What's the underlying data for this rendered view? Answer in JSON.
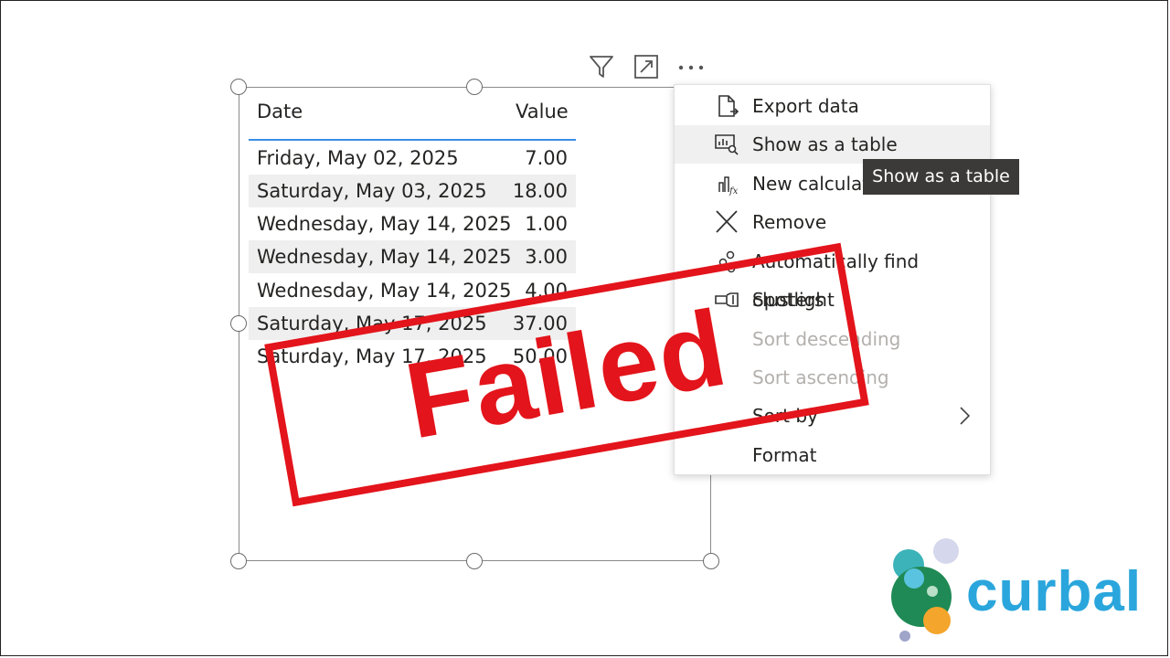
{
  "table": {
    "headers": {
      "date": "Date",
      "value": "Value"
    },
    "rows": [
      {
        "date": "Friday, May 02, 2025",
        "value": "7.00"
      },
      {
        "date": "Saturday, May 03, 2025",
        "value": "18.00"
      },
      {
        "date": "Wednesday, May 14, 2025",
        "value": "1.00"
      },
      {
        "date": "Wednesday, May 14, 2025",
        "value": "3.00"
      },
      {
        "date": "Wednesday, May 14, 2025",
        "value": "4.00"
      },
      {
        "date": "Saturday, May 17, 2025",
        "value": "37.00"
      },
      {
        "date": "Saturday, May 17, 2025",
        "value": "50.00"
      }
    ]
  },
  "visual_header_icons": [
    "filter-icon",
    "focus-mode-icon",
    "more-options-icon"
  ],
  "context_menu": {
    "items": [
      {
        "label": "Export data",
        "icon": "export-data-icon",
        "state": "normal"
      },
      {
        "label": "Show as a table",
        "icon": "show-as-table-icon",
        "state": "highlighted"
      },
      {
        "label": "New calculation",
        "icon": "new-calculation-icon",
        "state": "normal"
      },
      {
        "label": "Remove",
        "icon": "remove-icon",
        "state": "normal"
      },
      {
        "label": "Automatically find clusters",
        "icon": "clusters-icon",
        "state": "normal"
      },
      {
        "label": "Spotlight",
        "icon": "spotlight-icon",
        "state": "normal"
      },
      {
        "label": "Sort descending",
        "icon": "",
        "state": "disabled"
      },
      {
        "label": "Sort ascending",
        "icon": "",
        "state": "disabled"
      },
      {
        "label": "Sort by",
        "icon": "chevron-right-icon",
        "state": "submenu"
      },
      {
        "label": "Format",
        "icon": "",
        "state": "normal"
      }
    ]
  },
  "tooltip": {
    "text": "Show as a table"
  },
  "stamp": {
    "text": "Failed",
    "color": "#e3141b"
  },
  "logo": {
    "text": "curbal",
    "color": "#2aa6dc"
  },
  "colors": {
    "header_underline": "#3a8ee6",
    "alt_row": "#efefef",
    "tooltip_bg": "#3b3a39"
  }
}
